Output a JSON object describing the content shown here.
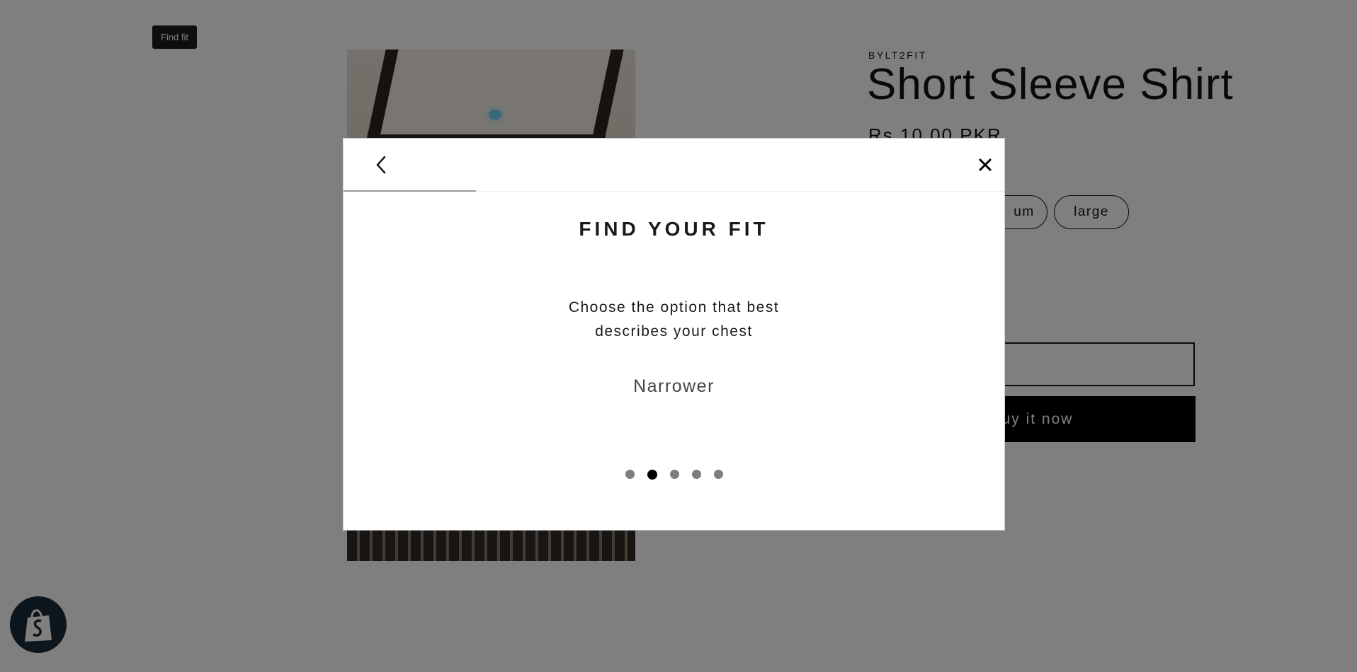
{
  "page": {
    "find_fit_label": "Find fit",
    "vendor": "BYLT2FIT",
    "product_title": "Short Sleeve Shirt",
    "price": "Rs.10.00 PKR",
    "sizes": [
      "medium",
      "large"
    ],
    "visible_size_labels": [
      "um",
      "large"
    ],
    "buy_now_label": "uy it now",
    "shop_badge_icon": "shopify-bag-icon"
  },
  "modal": {
    "back_icon": "chevron-left-icon",
    "close_icon": "close-icon",
    "progress": 0.2,
    "heading": "FIND YOUR FIT",
    "question_line1": "Choose the option that best",
    "question_line2": "describes your chest",
    "option": "Narrower",
    "steps_total": 5,
    "active_step": 2
  },
  "colors": {
    "overlay": "#000000",
    "button_dark": "#000000",
    "dot_inactive": "#7d7d7d",
    "dot_active": "#000000"
  }
}
